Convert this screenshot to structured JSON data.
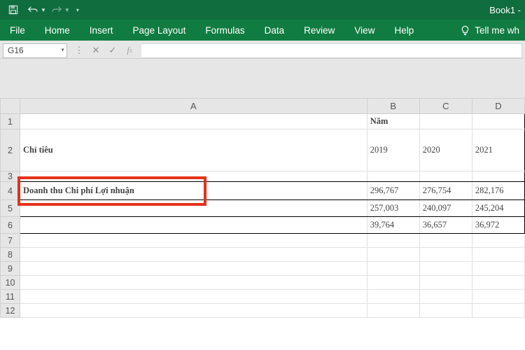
{
  "titlebar": {
    "book": "Book1  -"
  },
  "ribbon": {
    "tabs": [
      "File",
      "Home",
      "Insert",
      "Page Layout",
      "Formulas",
      "Data",
      "Review",
      "View",
      "Help"
    ],
    "tell": "Tell me wh"
  },
  "namebox": {
    "ref": "G16"
  },
  "columns": {
    "A": "A",
    "B": "B",
    "C": "C",
    "D": "D"
  },
  "rows": [
    "1",
    "2",
    "3",
    "4",
    "5",
    "6",
    "7",
    "8",
    "9",
    "10",
    "11",
    "12"
  ],
  "sheet": {
    "header_year": "Năm",
    "header_criteria": "Chỉ tiêu",
    "years": {
      "y2019": "2019",
      "y2020": "2020",
      "y2021": "2021"
    },
    "row4_A": "Doanh thu Chi phí Lợi nhuận",
    "data": {
      "r4": {
        "b": "296,767",
        "c": "276,754",
        "d": "282,176"
      },
      "r5": {
        "b": "257,003",
        "c": "240,097",
        "d": "245,204"
      },
      "r6": {
        "b": "39,764",
        "c": "36,657",
        "d": "36,972"
      }
    }
  }
}
